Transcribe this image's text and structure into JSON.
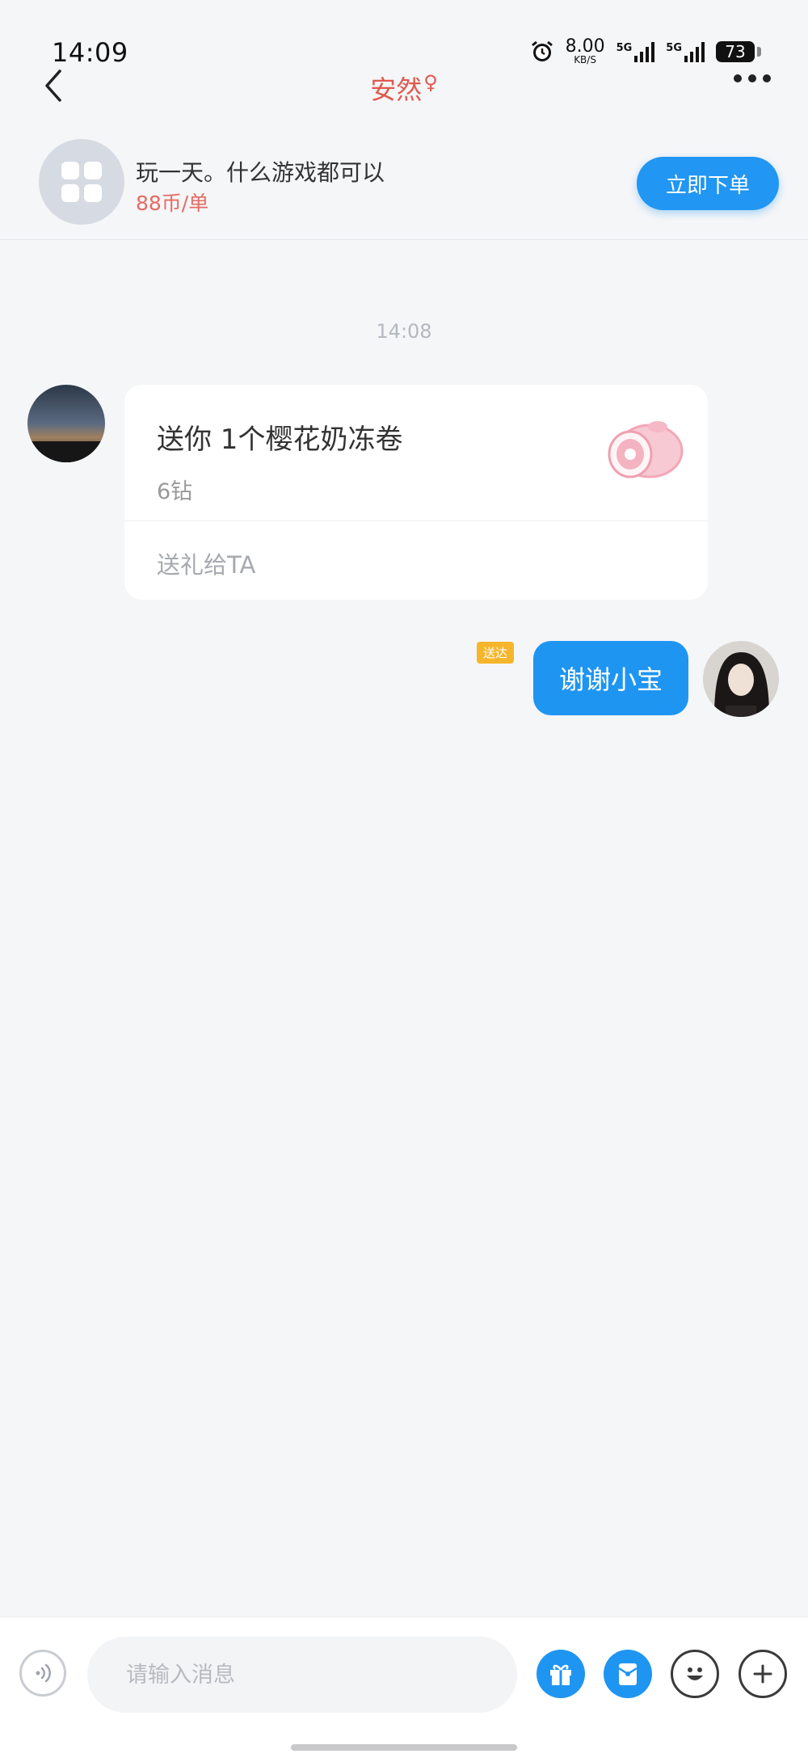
{
  "status_bar": {
    "time": "14:09",
    "net_speed_value": "8.00",
    "net_speed_unit": "KB/S",
    "signal1_label": "5G",
    "signal2_label": "5G",
    "battery": "73",
    "icons": [
      "alarm-icon",
      "signal-icon",
      "signal-icon",
      "battery-icon"
    ]
  },
  "nav": {
    "title": "安然",
    "gender_symbol": "♀",
    "back_icon": "back-chevron-icon",
    "more_icon": "more-dots-icon"
  },
  "service": {
    "title": "玩一天。什么游戏都可以",
    "price": "88币/单",
    "order_button": "立即下单",
    "icon": "app-grid-icon"
  },
  "chat": {
    "timestamp": "14:08",
    "gift_message": {
      "title": "送你 1个樱花奶冻卷",
      "cost": "6钻",
      "action": "送礼给TA",
      "gift_icon": "sakura-cake-roll-icon"
    },
    "my_message": {
      "status": "送达",
      "text": "谢谢小宝"
    }
  },
  "input_bar": {
    "placeholder": "请输入消息",
    "icons": [
      "voice-icon",
      "gift-icon",
      "red-packet-icon",
      "emoji-icon",
      "plus-icon"
    ]
  },
  "colors": {
    "accent_blue": "#1f95f2",
    "title_red": "#e0584e",
    "price_red": "#e56b63",
    "delivered_badge": "#f5b62b",
    "background": "#f5f6f8"
  }
}
